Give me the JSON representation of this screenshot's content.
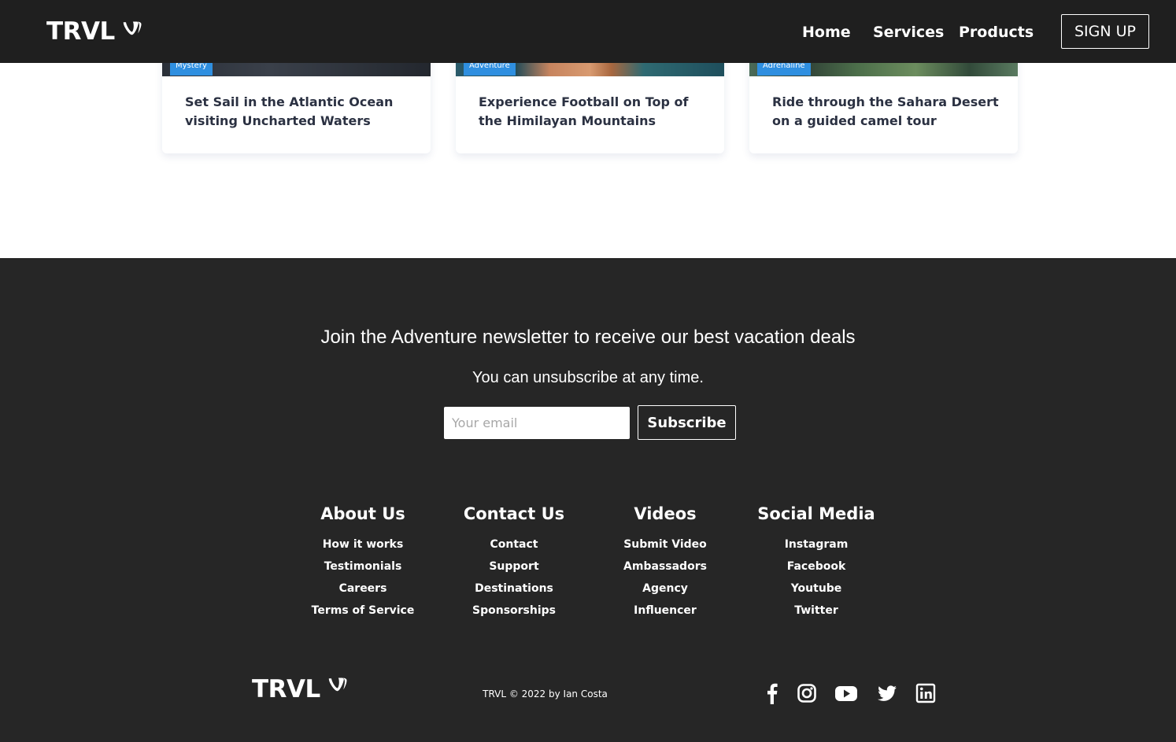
{
  "brand": {
    "logo_text": "TRVL"
  },
  "nav": {
    "links": [
      "Home",
      "Services",
      "Products"
    ],
    "signup_label": "SIGN UP"
  },
  "cards": [
    {
      "tag": "Mystery",
      "title": "Set Sail in the Atlantic Ocean visiting Uncharted Waters"
    },
    {
      "tag": "Adventure",
      "title": "Experience Football on Top of the Himilayan Mountains"
    },
    {
      "tag": "Adrenaline",
      "title": "Ride through the Sahara Desert on a guided camel tour"
    }
  ],
  "newsletter": {
    "heading": "Join the Adventure newsletter to receive our best vacation deals",
    "subtext": "You can unsubscribe at any time.",
    "email_placeholder": "Your email",
    "subscribe_label": "Subscribe"
  },
  "footer_links": [
    {
      "heading": "About Us",
      "items": [
        "How it works",
        "Testimonials",
        "Careers",
        "Terms of Service"
      ]
    },
    {
      "heading": "Contact Us",
      "items": [
        "Contact",
        "Support",
        "Destinations",
        "Sponsorships"
      ]
    },
    {
      "heading": "Videos",
      "items": [
        "Submit Video",
        "Ambassadors",
        "Agency",
        "Influencer"
      ]
    },
    {
      "heading": "Social Media",
      "items": [
        "Instagram",
        "Facebook",
        "Youtube",
        "Twitter"
      ]
    }
  ],
  "footer": {
    "logo_text": "TRVL",
    "copyright": "TRVL © 2022 by Ian Costa",
    "social_icons": [
      "facebook-icon",
      "instagram-icon",
      "youtube-icon",
      "twitter-icon",
      "linkedin-icon"
    ]
  },
  "colors": {
    "nav_bg": "#1f1f1f",
    "footer_bg": "#262626",
    "tag_bg": "#2f8fe0",
    "card_title": "#2b3142"
  }
}
